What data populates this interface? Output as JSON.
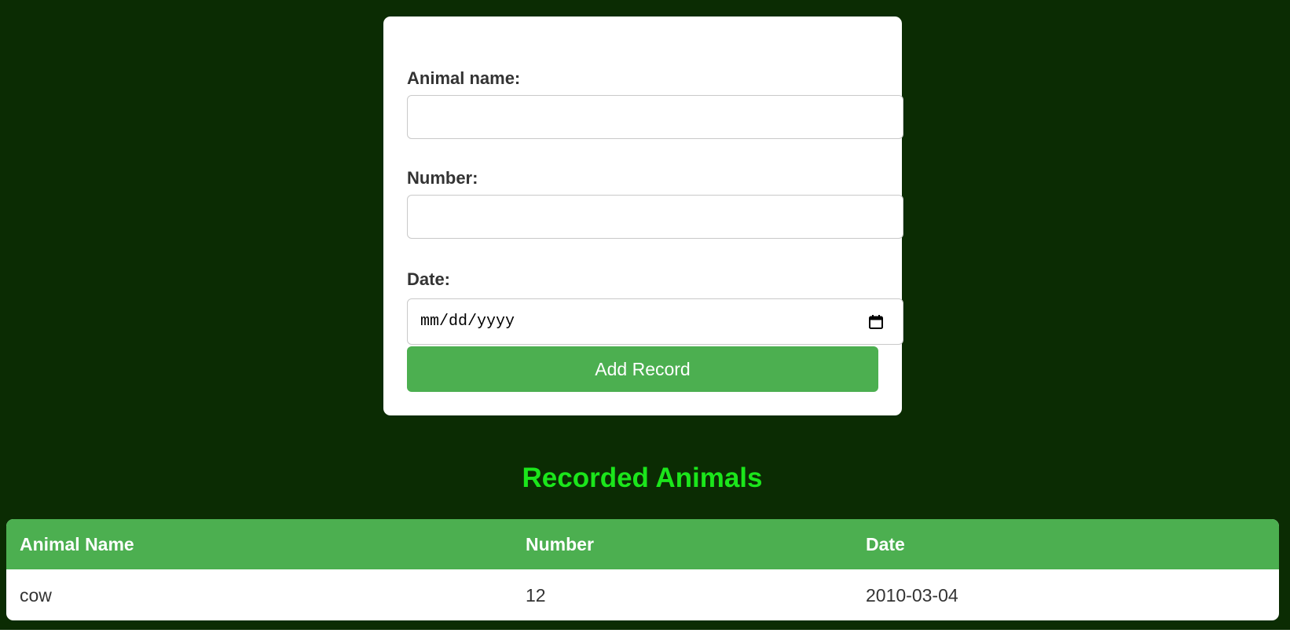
{
  "form": {
    "animal_name_label": "Animal name:",
    "animal_name_value": "",
    "number_label": "Number:",
    "number_value": "",
    "date_label": "Date:",
    "date_placeholder": "mm/dd/yyyy",
    "submit_label": "Add Record"
  },
  "records": {
    "title": "Recorded Animals",
    "columns": [
      "Animal Name",
      "Number",
      "Date"
    ],
    "rows": [
      [
        "cow",
        "12",
        "2010-03-04"
      ]
    ]
  },
  "colors": {
    "background": "#0b2c03",
    "accent": "#4caf50",
    "title": "#1be61b"
  },
  "icons": {
    "date_picker": "calendar-icon"
  }
}
